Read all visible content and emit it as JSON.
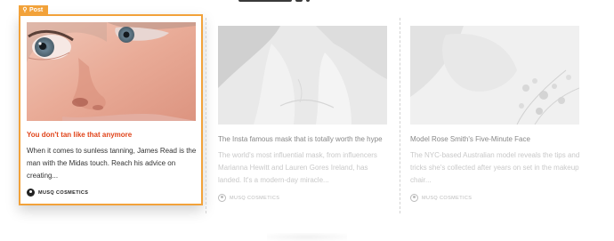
{
  "post_tag": {
    "label": "Post",
    "icon": "pin-icon"
  },
  "cards": [
    {
      "title": "You don't tan like that anymore",
      "excerpt": "When it comes to sunless tanning, James Read is the man with the Midas touch. Reach his advice on creating...",
      "author": "MUSQ COSMETICS",
      "state": "active"
    },
    {
      "title": "The Insta famous mask that is totally worth the hype",
      "excerpt": "The world's most influential mask, from influencers Marianna Hewitt and Lauren Gores Ireland, has landed. It's a modern-day miracle...",
      "author": "MUSQ COSMETICS",
      "state": "faded"
    },
    {
      "title": "Model Rose Smith's Five-Minute Face",
      "excerpt": "The NYC-based Australian model reveals the tips and tricks she's collected after years on set in the makeup chair...",
      "author": "MUSQ COSMETICS",
      "state": "faded"
    }
  ],
  "colors": {
    "accent": "#f2a23a",
    "title_active": "#e0441a"
  }
}
